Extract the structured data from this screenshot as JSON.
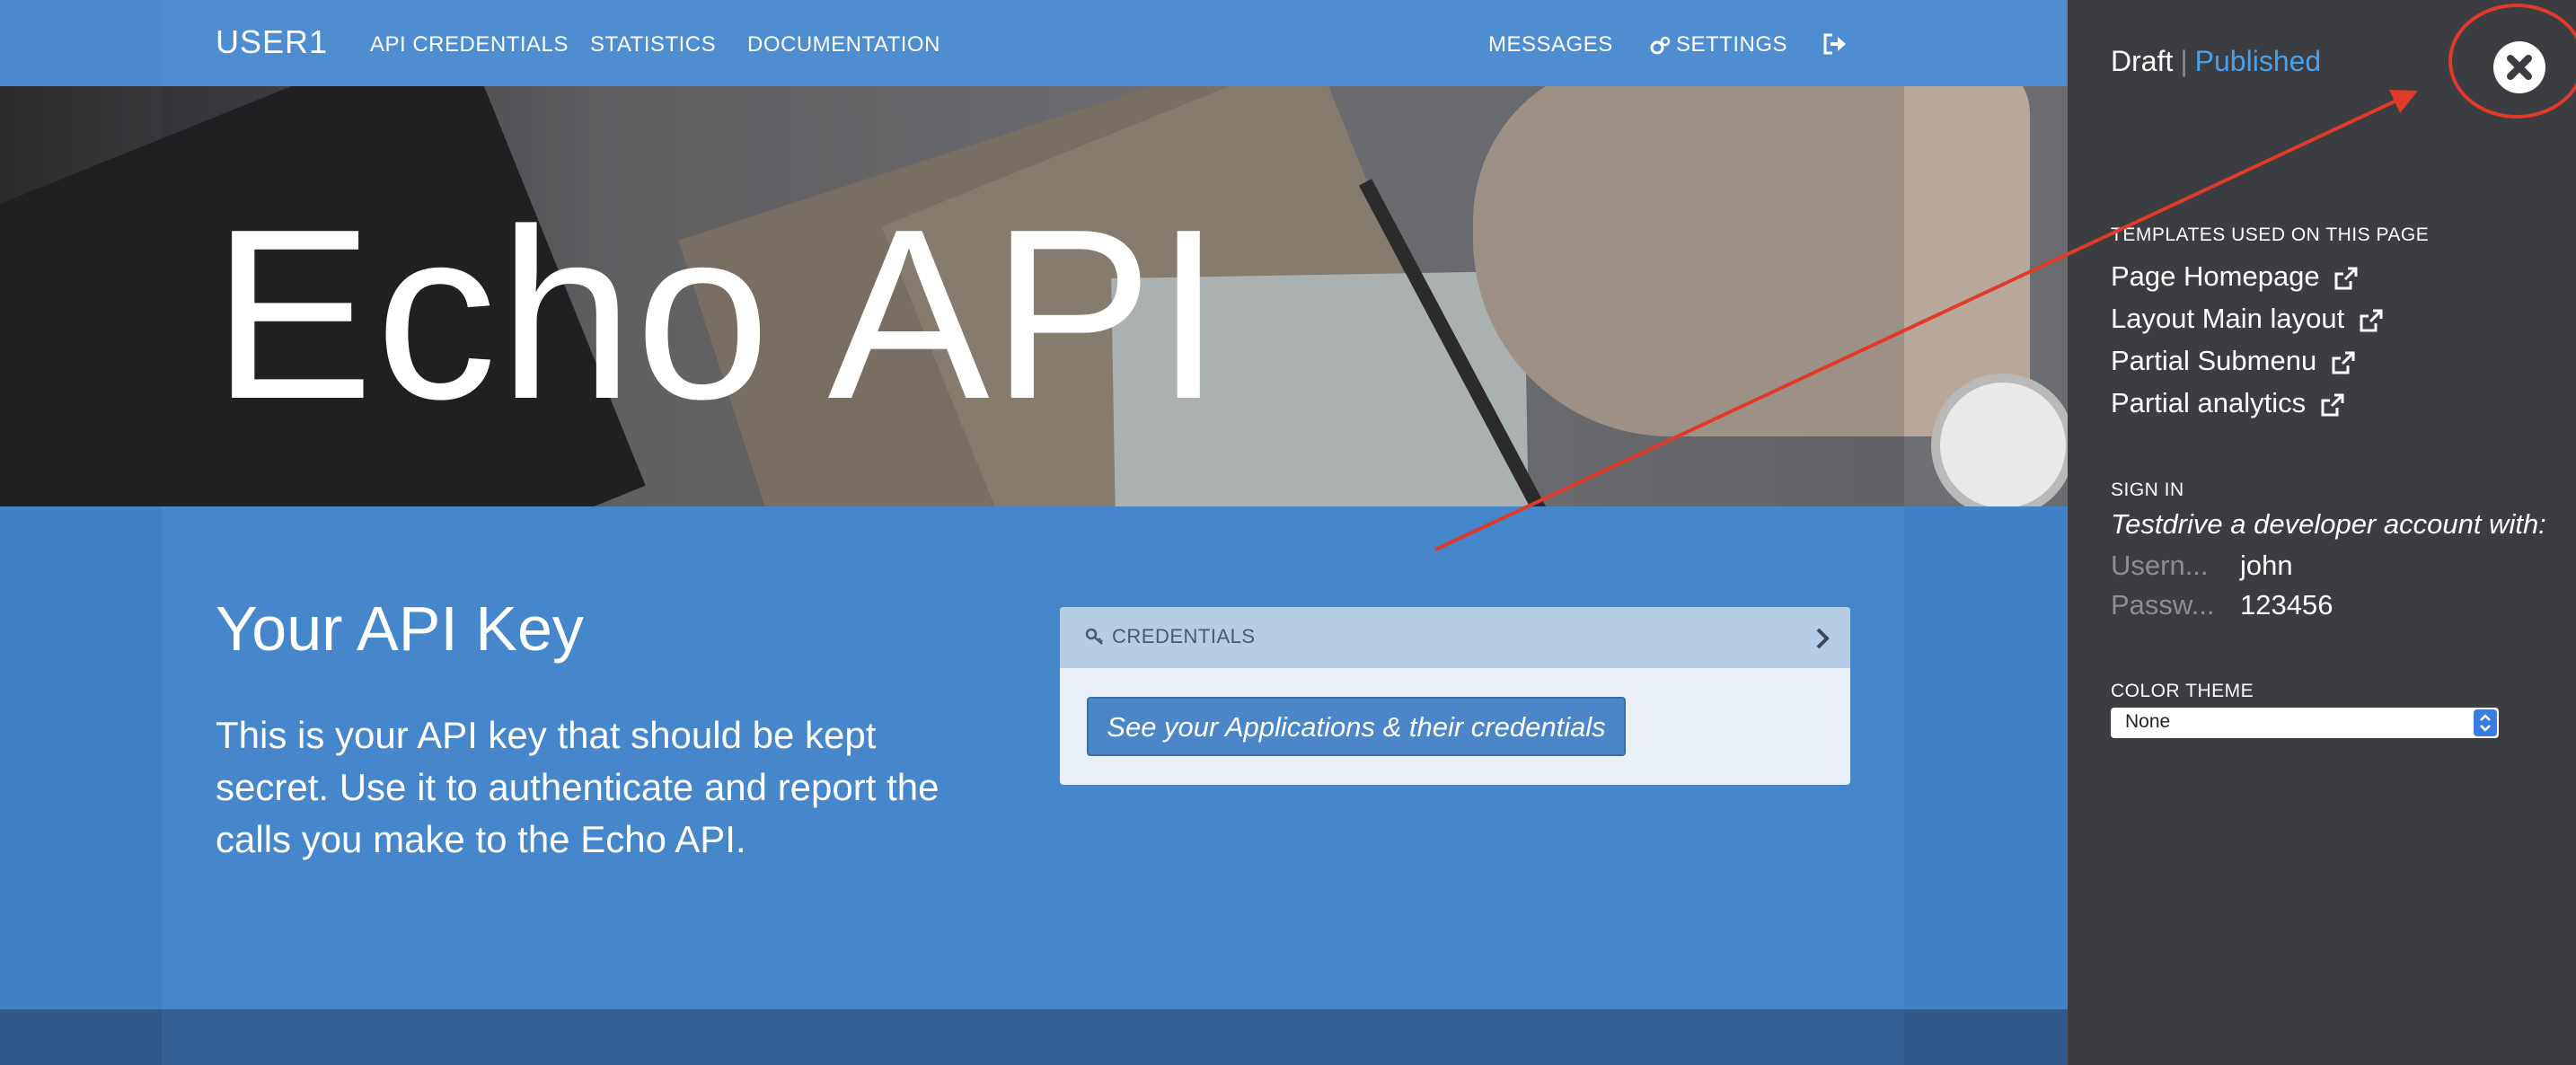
{
  "nav": {
    "brand": "USER1",
    "links": [
      "API CREDENTIALS",
      "STATISTICS",
      "DOCUMENTATION"
    ],
    "right": [
      "MESSAGES",
      "SETTINGS"
    ]
  },
  "hero": {
    "title": "Echo API"
  },
  "main": {
    "heading": "Your API Key",
    "text": "This is your API key that should be kept secret. Use it to authenticate and report the calls you make to the Echo API."
  },
  "credentials": {
    "title": "CREDENTIALS",
    "button": "See your Applications & their credentials"
  },
  "panel": {
    "status_draft": "Draft",
    "status_sep": "|",
    "status_published": "Published",
    "templates_label": "TEMPLATES USED ON THIS PAGE",
    "templates": [
      "Page Homepage",
      "Layout Main layout",
      "Partial Submenu",
      "Partial analytics"
    ],
    "signin_label": "SIGN IN",
    "signin_note": "Testdrive a developer account with:",
    "username_label": "Usern...",
    "username_value": "john",
    "password_label": "Passw...",
    "password_value": "123456",
    "color_theme_label": "COLOR THEME",
    "color_theme_value": "None"
  },
  "colors": {
    "accent": "#4a86c8",
    "published": "#4aa0e6",
    "annotation": "#e03a2a",
    "panel_bg": "#3c3d41"
  }
}
